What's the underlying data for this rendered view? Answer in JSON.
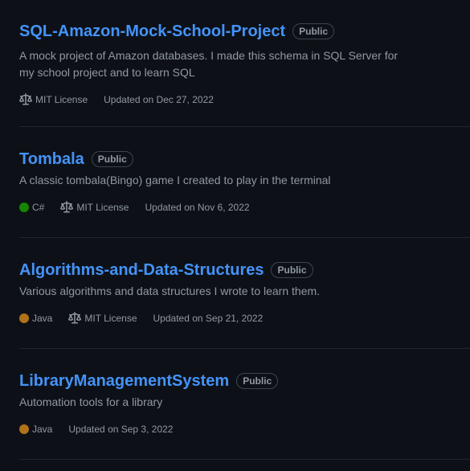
{
  "repos": [
    {
      "name": "SQL-Amazon-Mock-School-Project",
      "visibility": "Public",
      "description": "A mock project of Amazon databases. I made this schema in SQL Server for my school project and to learn SQL",
      "language": null,
      "language_color": null,
      "license": "MIT License",
      "updated": "Updated on Dec 27, 2022"
    },
    {
      "name": "Tombala",
      "visibility": "Public",
      "description": "A classic tombala(Bingo) game I created to play in the terminal",
      "language": "C#",
      "language_color": "#178600",
      "license": "MIT License",
      "updated": "Updated on Nov 6, 2022"
    },
    {
      "name": "Algorithms-and-Data-Structures",
      "visibility": "Public",
      "description": "Various algorithms and data structures I wrote to learn them.",
      "language": "Java",
      "language_color": "#b07219",
      "license": "MIT License",
      "updated": "Updated on Sep 21, 2022"
    },
    {
      "name": "LibraryManagementSystem",
      "visibility": "Public",
      "description": "Automation tools for a library",
      "language": "Java",
      "language_color": "#b07219",
      "license": null,
      "updated": "Updated on Sep 3, 2022"
    }
  ],
  "icons": {
    "license": "law-icon",
    "language": "language-color-dot"
  }
}
